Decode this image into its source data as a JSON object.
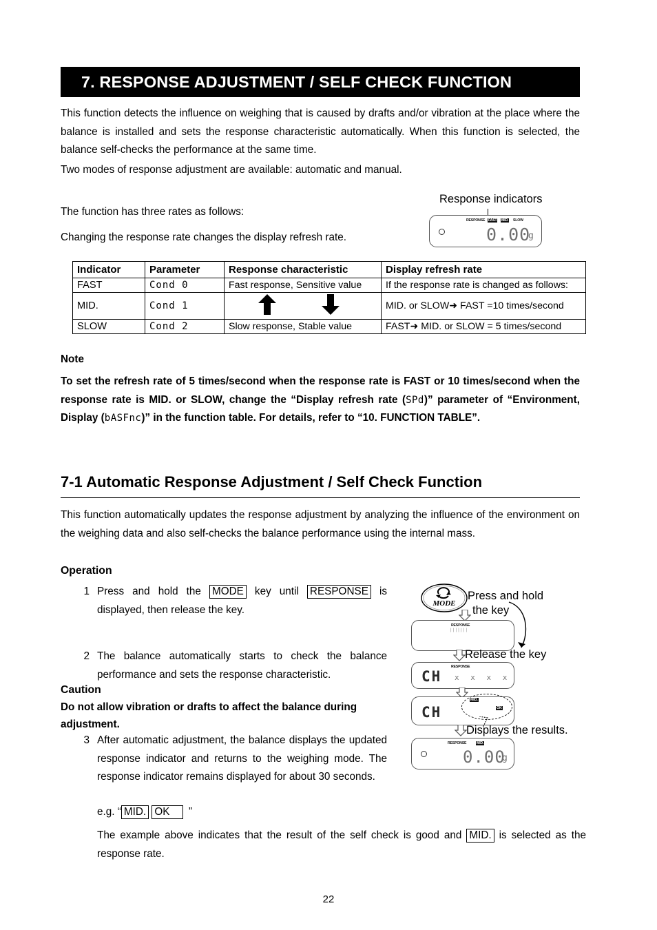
{
  "page": {
    "number": "22",
    "section_banner": "7.  RESPONSE ADJUSTMENT / SELF CHECK FUNCTION"
  },
  "intro": {
    "paragraph1": "This function detects the influence on weighing that is caused by drafts and/or vibration at the place where the balance is installed and sets the response characteristic automatically. When this function is selected, the balance self-checks the performance at the same time.",
    "paragraph2": "Two modes of response adjustment are available: automatic and    manual.",
    "paragraph3": "The function has three rates as follows:",
    "paragraph4": "Changing the response rate changes the display refresh rate."
  },
  "response_indicator_callout": {
    "label": "Response indicators",
    "display": {
      "response_word": "RESPONSE",
      "indicators": [
        {
          "label": "FAST",
          "active": true
        },
        {
          "label": "MID.",
          "active": true
        },
        {
          "label": "SLOW",
          "active": false
        }
      ],
      "value": "0.00",
      "unit": "g"
    }
  },
  "table": {
    "headers": [
      "Indicator",
      "Parameter",
      "Response characteristic",
      "Display refresh rate"
    ],
    "rows": [
      {
        "indicator": "FAST",
        "parameter": "Cond 0",
        "characteristic": "Fast response, Sensitive value",
        "refresh": "If the response rate is changed as follows:"
      },
      {
        "indicator": "MID.",
        "parameter": "Cond 1",
        "characteristic": "",
        "refresh": "MID. or SLOW➜ FAST =10 times/second"
      },
      {
        "indicator": "SLOW",
        "parameter": "Cond 2",
        "characteristic": "Slow response, Stable value",
        "refresh": "FAST➜ MID. or SLOW = 5 times/second"
      }
    ]
  },
  "note": {
    "heading": "Note",
    "line1_a": "To set the refresh rate of 5 times/second when the response rate is FAST or 10 times/second when the response rate is MID. or SLOW, change the “Display refresh rate (",
    "param_spd": "SPd",
    "line1_b": ")” parameter of “Environment, Display (",
    "param_basfnc": "bASFnc",
    "line1_c": ")” in the function table. For details, refer to “10.   FUNCTION TABLE”."
  },
  "subsection": {
    "heading": "7-1  Automatic Response Adjustment / Self Check Function",
    "paragraph": "This function automatically updates the response adjustment by analyzing the influence of the environment on the weighing data and also self-checks the balance performance using the internal mass."
  },
  "operation": {
    "heading": "Operation",
    "steps": [
      {
        "num": "1",
        "text_a": "Press and hold the ",
        "key1": "MODE",
        "text_b": " key until ",
        "key2": "RESPONSE",
        "text_c": " is displayed, then release the key."
      },
      {
        "num": "2",
        "text": "The balance automatically starts to check the balance performance and sets the response characteristic."
      },
      {
        "num": "3",
        "text": "After automatic adjustment, the balance displays the updated response indicator and returns to the weighing mode. The response indicator remains displayed for about 30 seconds.",
        "example_prefix": "e.g. “",
        "example_key1": "MID.",
        "example_key2": "OK",
        "example_suffix": "”"
      }
    ],
    "caution": {
      "heading": "Caution",
      "text": "Do not allow vibration or drafts to affect the balance during adjustment."
    },
    "closing_a": "The example above indicates that the result of the self check is good and ",
    "closing_key": "MID.",
    "closing_b": " is selected as the response rate."
  },
  "illustration": {
    "mode_key_label": "MODE",
    "mode_key_icon": "refresh-circular-arrow-icon",
    "captions": [
      "Press and hold",
      "the key",
      "Release the key",
      "Displays the results."
    ],
    "panels": [
      {
        "name": "panel-blank",
        "response_word": "RESPONSE",
        "main": ""
      },
      {
        "name": "panel-ch-checking",
        "response_word": "RESPONSE",
        "main": "CH",
        "secondary": "x x x x"
      },
      {
        "name": "panel-ch-result",
        "response_word": "",
        "main": "CH",
        "bubble": {
          "badge1": "MID.",
          "badge2": "OK"
        }
      },
      {
        "name": "panel-weighing",
        "response_word": "RESPONSE",
        "indicator_on": "MID.",
        "main": "0.00",
        "unit": "g"
      }
    ]
  },
  "colors": {
    "banner_bg": "#000000",
    "banner_fg": "#ffffff",
    "lcd_digit": "#6f6f6f",
    "border": "#000000"
  }
}
